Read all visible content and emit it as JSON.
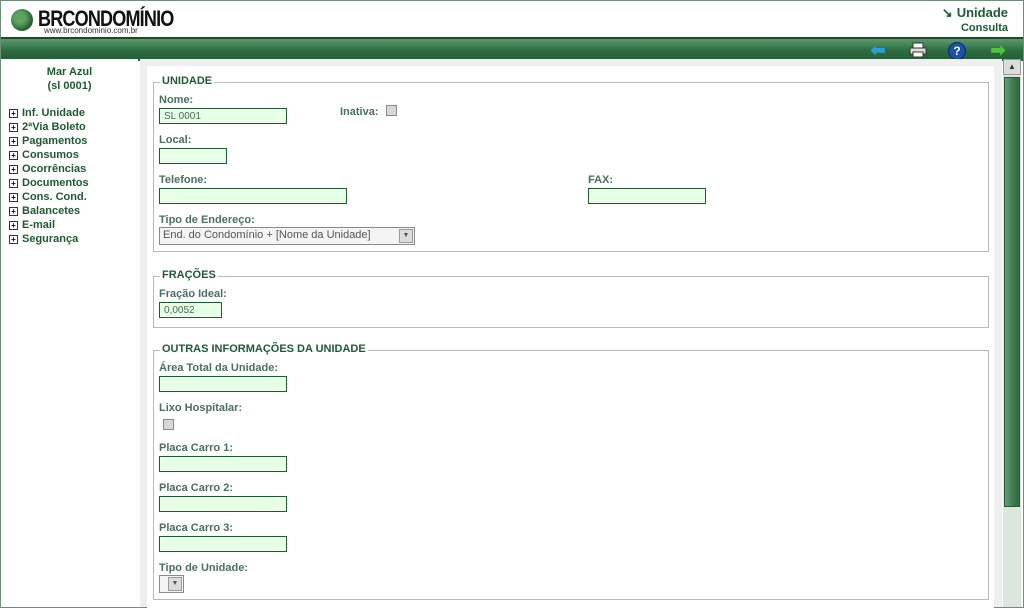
{
  "header": {
    "logo_text": "BRCONDOMÍNIO",
    "logo_url": "www.brcondominio.com.br",
    "title": "Unidade",
    "subtitle": "Consulta"
  },
  "toolbar": {
    "icons": [
      "back-arrow-icon",
      "print-icon",
      "help-icon",
      "forward-arrow-icon"
    ]
  },
  "sidebar": {
    "condo_name": "Mar Azul",
    "unit_code": "(sl 0001)",
    "items": [
      {
        "label": "Inf. Unidade"
      },
      {
        "label": "2ªVia Boleto"
      },
      {
        "label": "Pagamentos"
      },
      {
        "label": "Consumos"
      },
      {
        "label": "Ocorrências"
      },
      {
        "label": "Documentos"
      },
      {
        "label": "Cons. Cond."
      },
      {
        "label": "Balancetes"
      },
      {
        "label": "E-mail"
      },
      {
        "label": "Segurança"
      }
    ]
  },
  "unidade": {
    "legend": "UNIDADE",
    "nome_label": "Nome:",
    "nome_value": "SL 0001",
    "inativa_label": "Inativa:",
    "local_label": "Local:",
    "local_value": "",
    "telefone_label": "Telefone:",
    "telefone_value": "",
    "fax_label": "FAX:",
    "fax_value": "",
    "tipo_endereco_label": "Tipo de Endereço:",
    "tipo_endereco_value": "End. do Condomínio + [Nome da Unidade]"
  },
  "fracoes": {
    "legend": "FRAÇÕES",
    "fracao_label": "Fração Ideal:",
    "fracao_value": "0,0052"
  },
  "outras": {
    "legend": "OUTRAS INFORMAÇÕES DA UNIDADE",
    "area_label": "Área Total da Unidade:",
    "area_value": "",
    "lixo_label": "Lixo Hospitalar:",
    "placa1_label": "Placa Carro 1:",
    "placa1_value": "",
    "placa2_label": "Placa Carro 2:",
    "placa2_value": "",
    "placa3_label": "Placa Carro 3:",
    "placa3_value": "",
    "tipo_unidade_label": "Tipo de Unidade:",
    "tipo_unidade_value": ""
  },
  "colors": {
    "brand_green": "#1e5a32",
    "input_bg": "#e7ffe7",
    "bar_green": "#2e6e40"
  }
}
